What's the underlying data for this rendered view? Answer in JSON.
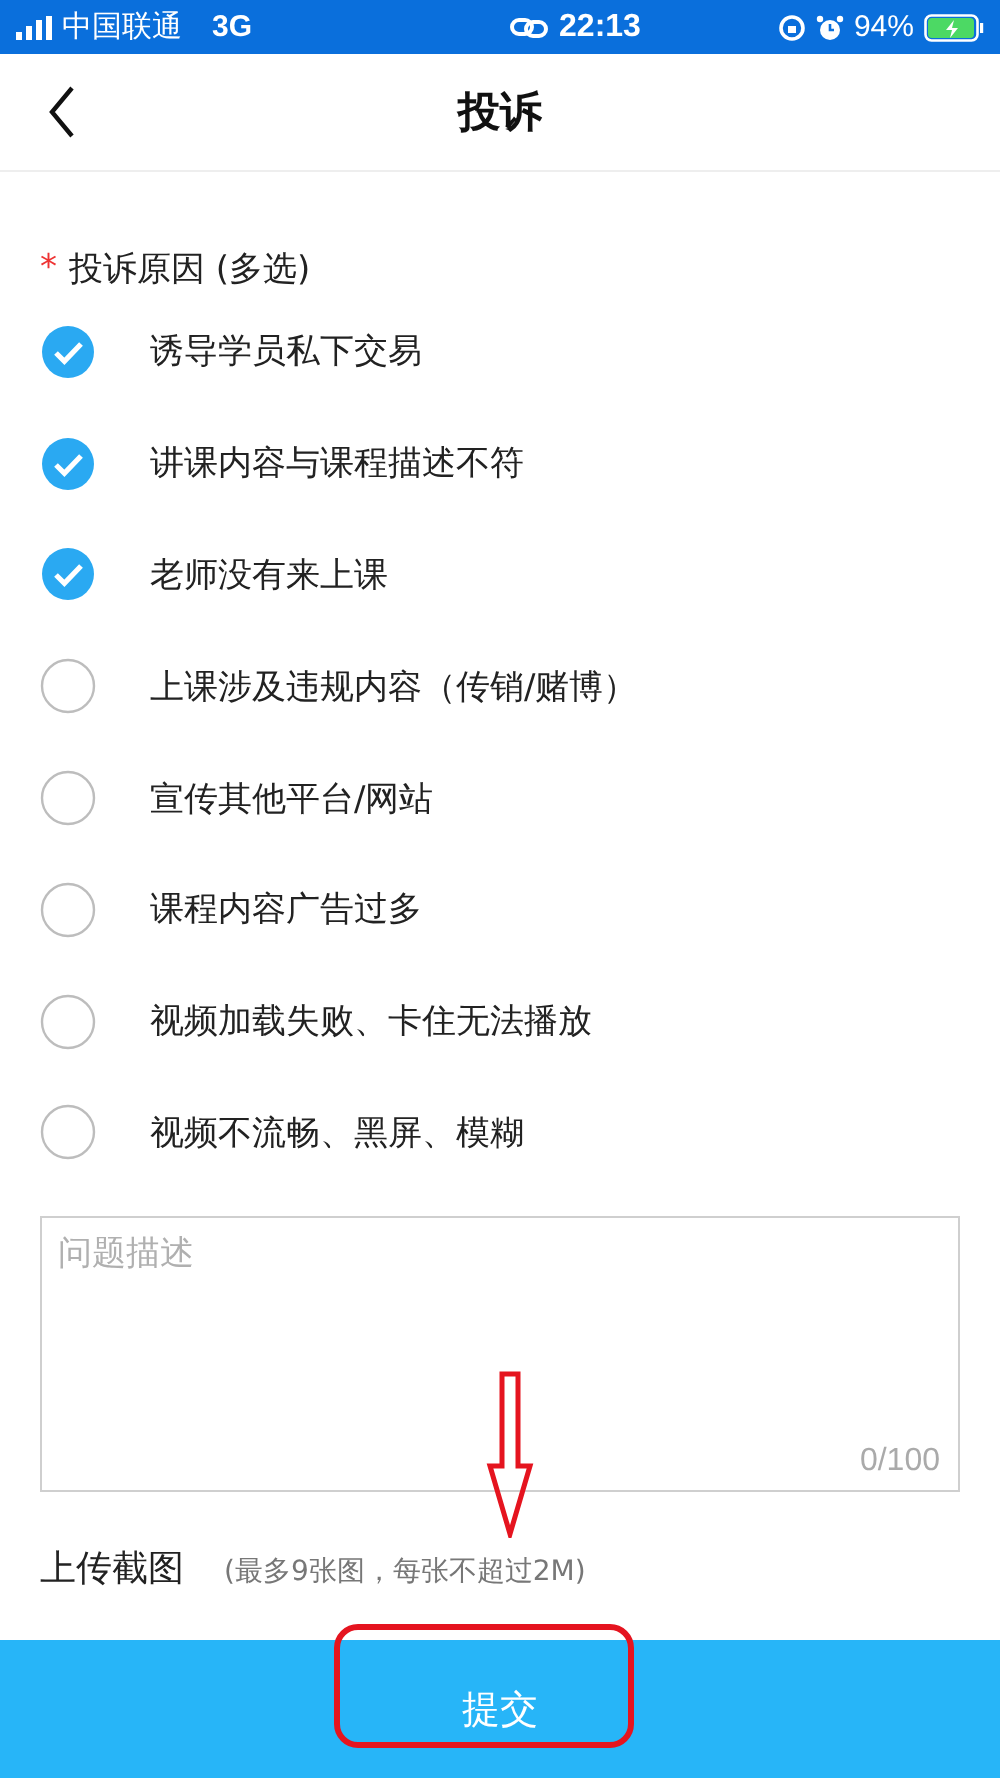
{
  "status_bar": {
    "carrier": "中国联通",
    "network": "3G",
    "time": "22:13",
    "battery": "94%"
  },
  "header": {
    "title": "投诉"
  },
  "reasons": {
    "required_mark": "*",
    "label": "投诉原因 (多选)",
    "items": [
      {
        "label": "诱导学员私下交易",
        "checked": true
      },
      {
        "label": "讲课内容与课程描述不符",
        "checked": true
      },
      {
        "label": "老师没有来上课",
        "checked": true
      },
      {
        "label": "上课涉及违规内容（传销/赌博）",
        "checked": false
      },
      {
        "label": "宣传其他平台/网站",
        "checked": false
      },
      {
        "label": "课程内容广告过多",
        "checked": false
      },
      {
        "label": "视频加载失败、卡住无法播放",
        "checked": false
      },
      {
        "label": "视频不流畅、黑屏、模糊",
        "checked": false
      }
    ]
  },
  "description": {
    "placeholder": "问题描述",
    "counter": "0/100"
  },
  "upload": {
    "label": "上传截图",
    "hint": "(最多9张图，每张不超过2M)"
  },
  "submit": "提交"
}
